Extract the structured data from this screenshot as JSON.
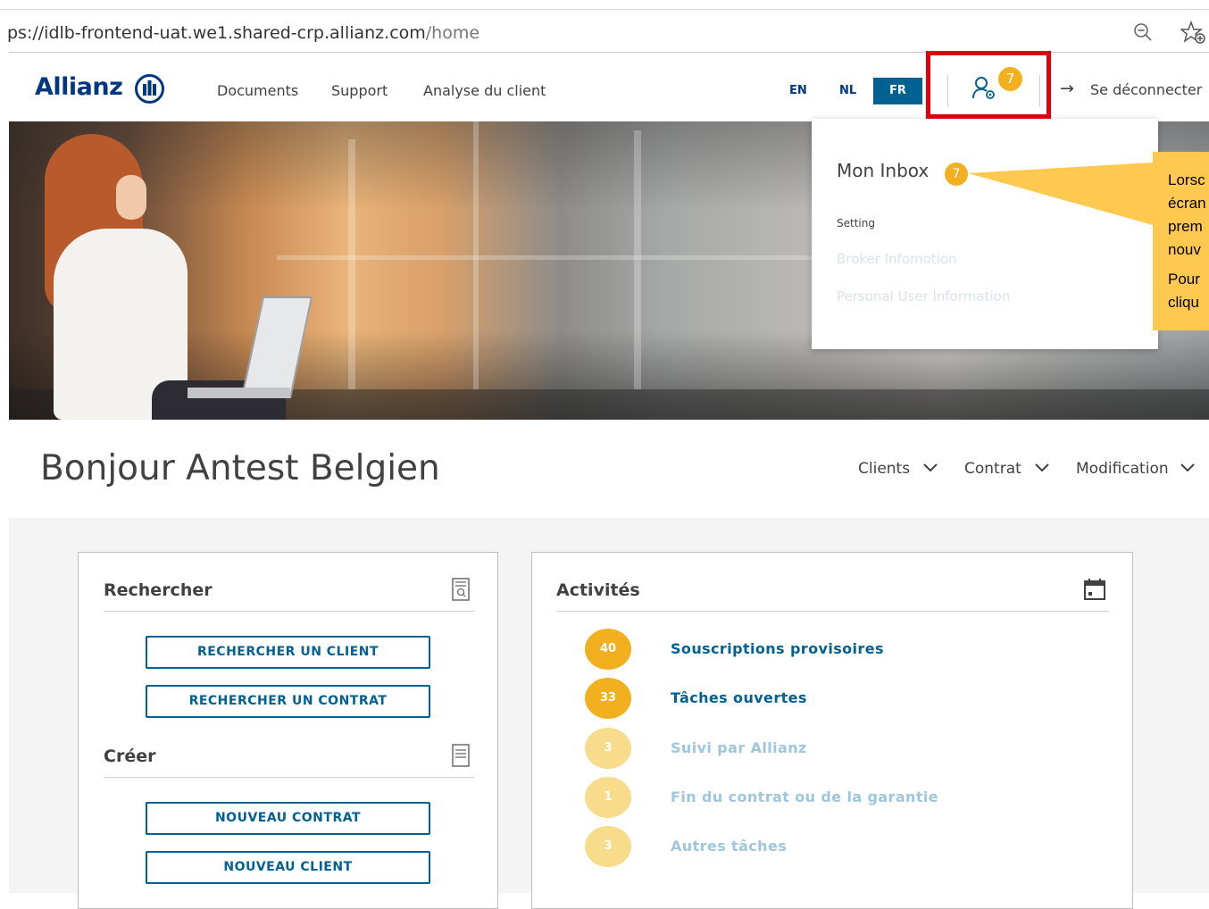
{
  "browser": {
    "url_host": "ps://idlb-frontend-uat.we1.shared-crp.allianz.com",
    "url_path": "/home"
  },
  "header": {
    "logo_text": "Allianz",
    "nav": [
      "Documents",
      "Support",
      "Analyse du client"
    ],
    "languages": [
      "EN",
      "NL",
      "FR"
    ],
    "active_language": "FR",
    "notification_count": "7",
    "logout_label": "Se déconnecter"
  },
  "dropdown": {
    "inbox_label": "Mon Inbox",
    "inbox_count": "7",
    "setting_label": "Setting",
    "broker_link": "Broker Infomotion",
    "personal_link": "Personal User Information"
  },
  "callout": {
    "lines": [
      "Lorsc",
      "écran",
      "prem",
      "nouv",
      "Pour",
      "cliqu"
    ]
  },
  "greeting": "Bonjour Antest Belgien",
  "top_menus": [
    "Clients",
    "Contrat",
    "Modification"
  ],
  "search_card": {
    "search_title": "Rechercher",
    "search_buttons": [
      "RECHERCHER UN CLIENT",
      "RECHERCHER UN CONTRAT"
    ],
    "create_title": "Créer",
    "create_buttons": [
      "NOUVEAU CONTRAT",
      "NOUVEAU CLIENT"
    ]
  },
  "activity_card": {
    "title": "Activités",
    "items": [
      {
        "count": "40",
        "label": "Souscriptions provisoires",
        "active": true
      },
      {
        "count": "33",
        "label": "Tâches ouvertes",
        "active": true
      },
      {
        "count": "3",
        "label": "Suivi par Allianz",
        "active": false
      },
      {
        "count": "1",
        "label": "Fin du contrat ou de la garantie",
        "active": false
      },
      {
        "count": "3",
        "label": "Autres tâches",
        "active": false
      }
    ]
  },
  "colors": {
    "brand_blue": "#003781",
    "link_blue": "#006192",
    "badge_yellow": "#f2b01e",
    "highlight_red": "#e1000f",
    "callout_yellow": "#ffc94f"
  },
  "icons": [
    "zoom-out-icon",
    "favorite-star-icon",
    "user-settings-icon",
    "logout-arrow-icon",
    "search-document-icon",
    "document-icon",
    "calendar-icon",
    "chevron-down-icon"
  ]
}
